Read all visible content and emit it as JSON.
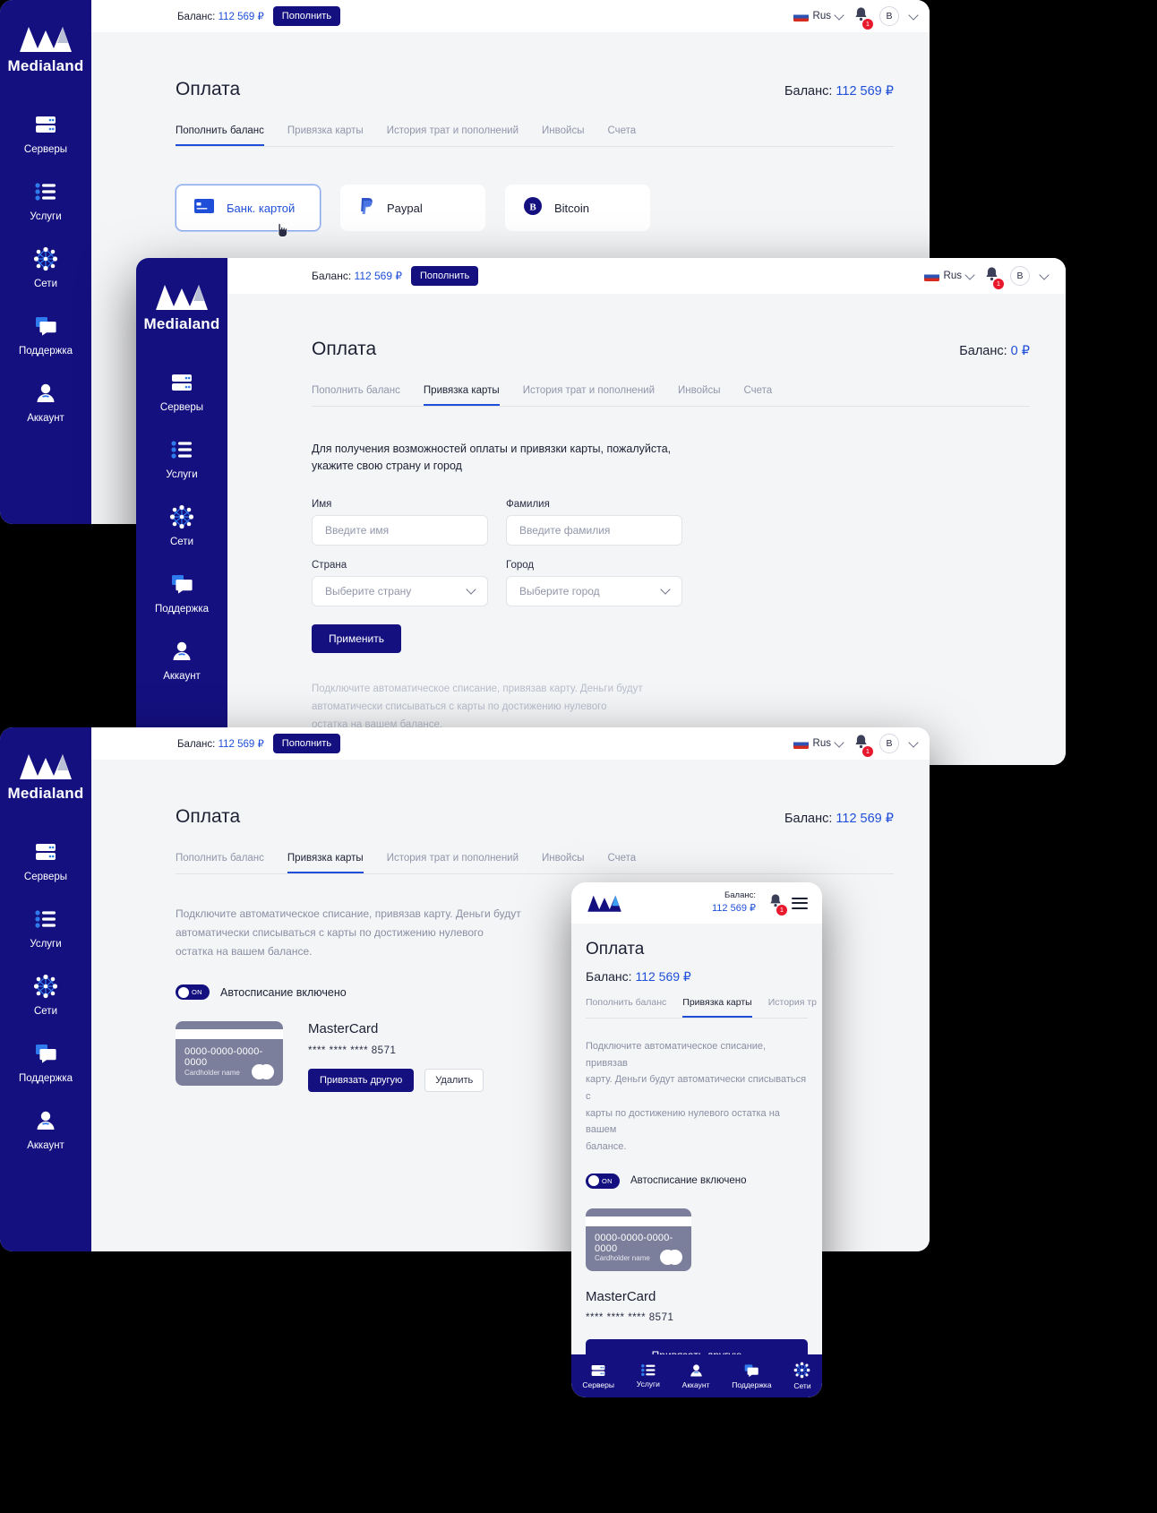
{
  "brand": {
    "name": "Medialand",
    "accent": "#141080",
    "link_blue": "#1f4fd8"
  },
  "sidebar": {
    "items": [
      {
        "label": "Серверы",
        "icon": "servers-icon"
      },
      {
        "label": "Услуги",
        "icon": "list-icon"
      },
      {
        "label": "Сети",
        "icon": "network-icon"
      },
      {
        "label": "Поддержка",
        "icon": "chat-icon"
      },
      {
        "label": "Аккаунт",
        "icon": "user-icon"
      }
    ]
  },
  "topbar": {
    "balance_label": "Баланс:",
    "balance_value": "112 569 ₽",
    "topup_button": "Пополнить",
    "lang": "Rus",
    "notifications_count": "1",
    "avatar_initial": "B"
  },
  "page": {
    "title": "Оплата",
    "balance_prefix": "Баланс: ",
    "balance_value": "112 569 ₽",
    "balance_zero": "0 ₽",
    "tabs": [
      "Пополнить баланс",
      "Привязка карты",
      "История трат и пополнений",
      "Инвойсы",
      "Счета"
    ]
  },
  "window1": {
    "active_tab": "Пополнить баланс",
    "payment_methods": [
      {
        "label": "Банк. картой",
        "icon": "bank-card-icon",
        "selected": true
      },
      {
        "label": "Paypal",
        "icon": "paypal-icon",
        "selected": false
      },
      {
        "label": "Bitcoin",
        "icon": "bitcoin-icon",
        "selected": false
      }
    ]
  },
  "window2": {
    "active_tab": "Привязка карты",
    "balance_value": "0 ₽",
    "intro_line1": "Для получения возможностей оплаты и привязки карты, пожалуйста,",
    "intro_line2": "укажите свою страну и город",
    "fields": [
      {
        "label": "Имя",
        "placeholder": "Введите имя",
        "type": "text"
      },
      {
        "label": "Фамилия",
        "placeholder": "Введите фамилия",
        "type": "text"
      },
      {
        "label": "Страна",
        "placeholder": "Выберите страну",
        "type": "select"
      },
      {
        "label": "Город",
        "placeholder": "Выберите город",
        "type": "select"
      }
    ],
    "submit_button": "Применить",
    "footer_note_l1": "Подключите автоматическое списание, привязав карту. Деньги будут",
    "footer_note_l2": "автоматически списываться с карты по достижению нулевого",
    "footer_note_l3": "остатка на вашем балансе."
  },
  "window3": {
    "active_tab": "Привязка карты",
    "note_l1": "Подключите автоматическое списание, привязав карту. Деньги будут",
    "note_l2": "автоматически списываться с карты по достижению нулевого",
    "note_l3": "остатка на вашем балансе.",
    "toggle_state": "ON",
    "toggle_label": "Автосписание включено",
    "card": {
      "number_placeholder": "0000-0000-0000-0000",
      "holder_placeholder": "Cardholder name",
      "brand": "MasterCard",
      "masked": "**** **** **** 8571",
      "rebind_button": "Привязать другую",
      "delete_button": "Удалить"
    }
  },
  "mobile": {
    "balance_label": "Баланс:",
    "balance_value": "112 569 ₽",
    "title": "Оплата",
    "balance_line_prefix": "Баланс: ",
    "balance_line_value": "112 569 ₽",
    "tabs": [
      "Пополнить баланс",
      "Привязка карты",
      "История тр"
    ],
    "active_tab": "Привязка карты",
    "note_l1": "Подключите автоматическое списание, привязав",
    "note_l2": "карту. Деньги будут автоматически списываться с",
    "note_l3": "карты по достижению нулевого остатка на вашем",
    "note_l4": "балансе.",
    "toggle_state": "ON",
    "toggle_label": "Автосписание включено",
    "card": {
      "number_placeholder": "0000-0000-0000-0000",
      "holder_placeholder": "Cardholder name",
      "brand": "MasterCard",
      "masked": "**** **** **** 8571",
      "rebind_button": "Привязать другую"
    },
    "nav": [
      {
        "label": "Серверы",
        "icon": "servers-icon"
      },
      {
        "label": "Услуги",
        "icon": "list-icon"
      },
      {
        "label": "Аккаунт",
        "icon": "user-icon"
      },
      {
        "label": "Поддержка",
        "icon": "chat-icon"
      },
      {
        "label": "Сети",
        "icon": "network-icon"
      }
    ]
  }
}
